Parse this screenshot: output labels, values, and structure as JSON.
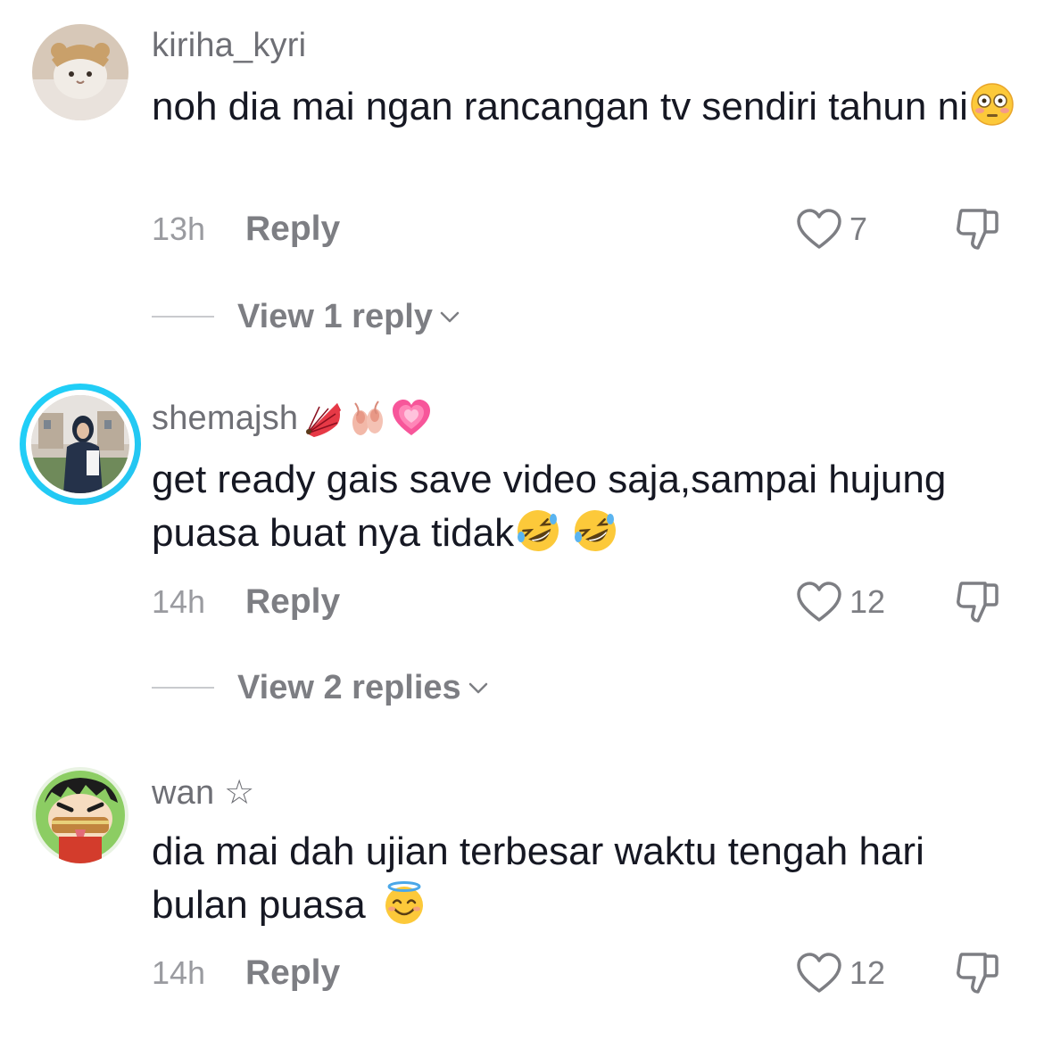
{
  "comments": [
    {
      "username": "kiriha_kyri",
      "text": "noh dia mai ngan rancangan tv sendiri tahun ni",
      "text_emoji": "flushed-face-emoji",
      "time": "13h",
      "reply_label": "Reply",
      "likes": "7",
      "view_replies": "View 1 reply"
    },
    {
      "username": "shemajsh",
      "username_emojis": [
        "fan-emoji",
        "ballet-shoes-emoji",
        "growing-heart-emoji"
      ],
      "text": "get ready gais save video saja,sampai hujung puasa buat nya tidak",
      "text_emoji": "rolling-on-floor-laughing-emoji",
      "time": "14h",
      "reply_label": "Reply",
      "likes": "12",
      "view_replies": "View 2 replies"
    },
    {
      "username": "wan ☆",
      "text": "dia mai dah ujian terbesar waktu tengah hari bulan puasa",
      "text_emoji": "smiling-face-with-halo-emoji",
      "time": "14h",
      "reply_label": "Reply",
      "likes": "12"
    }
  ],
  "colors": {
    "username": "#6e6f75",
    "body": "#161823",
    "meta": "#9a9ba0",
    "story_ring": "#1fd1f9"
  }
}
